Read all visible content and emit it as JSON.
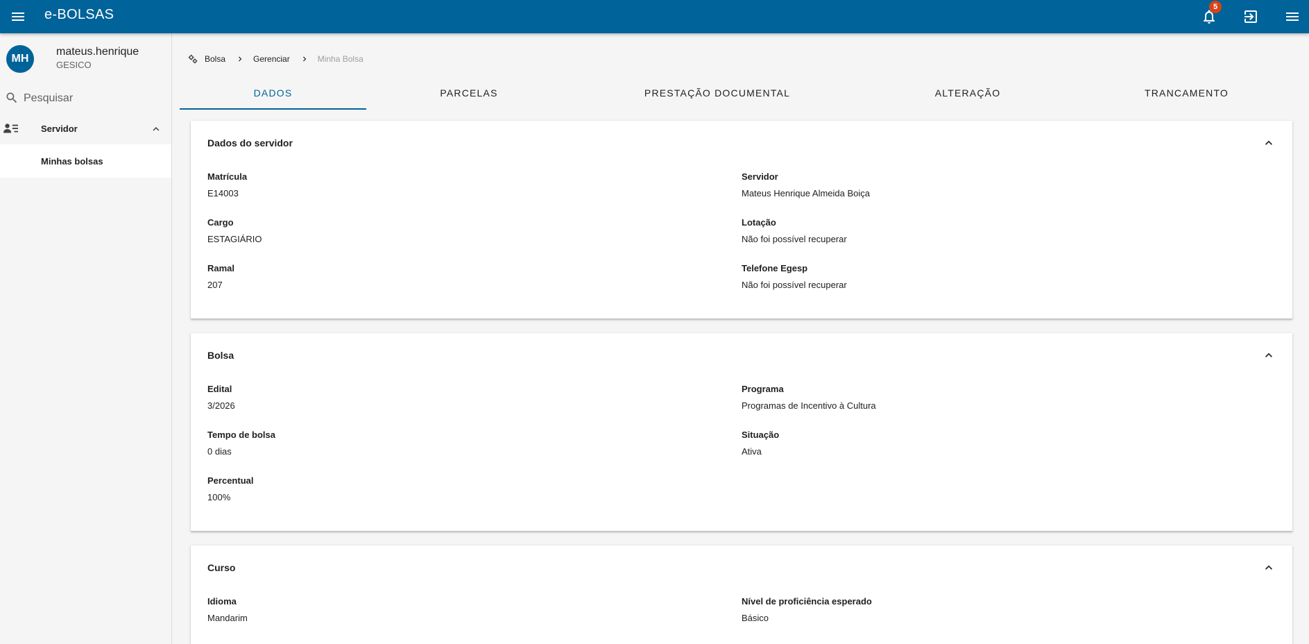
{
  "app": {
    "title": "e-BOLSAS",
    "notification_count": "5",
    "topbar_color": "#00639a"
  },
  "user": {
    "initials": "MH",
    "name": "mateus.henrique",
    "org": "GESICO"
  },
  "search": {
    "placeholder": "Pesquisar"
  },
  "sidebar": {
    "group_label": "Servidor",
    "items": [
      {
        "label": "Minhas bolsas"
      }
    ]
  },
  "breadcrumb": {
    "items": [
      "Bolsa",
      "Gerenciar",
      "Minha Bolsa"
    ]
  },
  "tabs": [
    "DADOS",
    "PARCELAS",
    "PRESTAÇÃO DOCUMENTAL",
    "ALTERAÇÃO",
    "TRANCAMENTO"
  ],
  "sections": {
    "servidor": {
      "title": "Dados do servidor",
      "fields": [
        {
          "label": "Matrícula",
          "value": "E14003"
        },
        {
          "label": "Servidor",
          "value": "Mateus Henrique Almeida Boiça"
        },
        {
          "label": "Cargo",
          "value": "ESTAGIÁRIO"
        },
        {
          "label": "Lotação",
          "value": "Não foi possível recuperar"
        },
        {
          "label": "Ramal",
          "value": "207"
        },
        {
          "label": "Telefone Egesp",
          "value": "Não foi possível recuperar"
        }
      ]
    },
    "bolsa": {
      "title": "Bolsa",
      "fields": [
        {
          "label": "Edital",
          "value": "3/2026"
        },
        {
          "label": "Programa",
          "value": "Programas de Incentivo à Cultura"
        },
        {
          "label": "Tempo de bolsa",
          "value": "0 dias"
        },
        {
          "label": "Situação",
          "value": "Ativa"
        },
        {
          "label": "Percentual",
          "value": "100%"
        }
      ]
    },
    "curso": {
      "title": "Curso",
      "fields": [
        {
          "label": "Idioma",
          "value": "Mandarim"
        },
        {
          "label": "Nível de proficiência esperado",
          "value": "Básico"
        }
      ]
    }
  }
}
